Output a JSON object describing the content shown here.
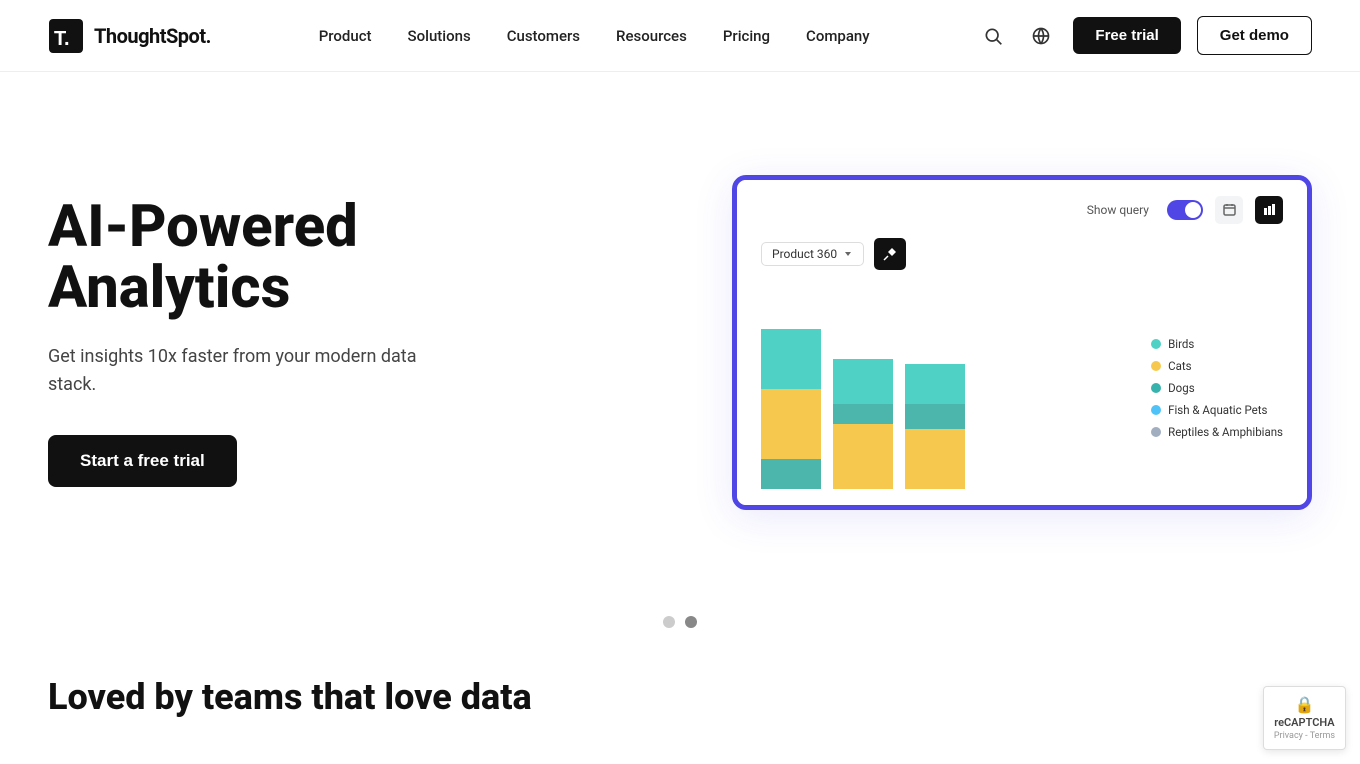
{
  "brand": {
    "name": "ThoughtSpot.",
    "logo_symbol": "T."
  },
  "nav": {
    "links": [
      {
        "id": "product",
        "label": "Product"
      },
      {
        "id": "solutions",
        "label": "Solutions"
      },
      {
        "id": "customers",
        "label": "Customers"
      },
      {
        "id": "resources",
        "label": "Resources"
      },
      {
        "id": "pricing",
        "label": "Pricing"
      },
      {
        "id": "company",
        "label": "Company"
      }
    ],
    "free_trial_label": "Free trial",
    "get_demo_label": "Get demo"
  },
  "hero": {
    "title_line1": "AI-Powered",
    "title_line2": "Analytics",
    "subtitle": "Get insights 10x faster from your modern data stack.",
    "cta_label": "Start a free trial"
  },
  "chart": {
    "show_query_label": "Show query",
    "product_select": "Product 360",
    "bars": [
      {
        "segments": [
          {
            "color": "#4fd1c5",
            "height": 60
          },
          {
            "color": "#f6c94e",
            "height": 70
          },
          {
            "color": "#4db6ac",
            "height": 30
          }
        ]
      },
      {
        "segments": [
          {
            "color": "#4fd1c5",
            "height": 45
          },
          {
            "color": "#4db6ac",
            "height": 20
          },
          {
            "color": "#f6c94e",
            "height": 65
          }
        ]
      },
      {
        "segments": [
          {
            "color": "#4fd1c5",
            "height": 40
          },
          {
            "color": "#4db6ac",
            "height": 25
          },
          {
            "color": "#f6c94e",
            "height": 60
          }
        ]
      }
    ],
    "legend": [
      {
        "label": "Birds",
        "color": "#4fd1c5"
      },
      {
        "label": "Cats",
        "color": "#f6c94e"
      },
      {
        "label": "Dogs",
        "color": "#38b2ac"
      },
      {
        "label": "Fish & Aquatic Pets",
        "color": "#4fc3f7"
      },
      {
        "label": "Reptiles & Amphibians",
        "color": "#a0aec0"
      }
    ]
  },
  "carousel": {
    "dots": [
      {
        "active": false
      },
      {
        "active": true
      }
    ]
  },
  "loved": {
    "title": "Loved by teams that love data"
  },
  "recaptcha": {
    "label": "reCAPTCHA",
    "sub": "Privacy - Terms"
  }
}
